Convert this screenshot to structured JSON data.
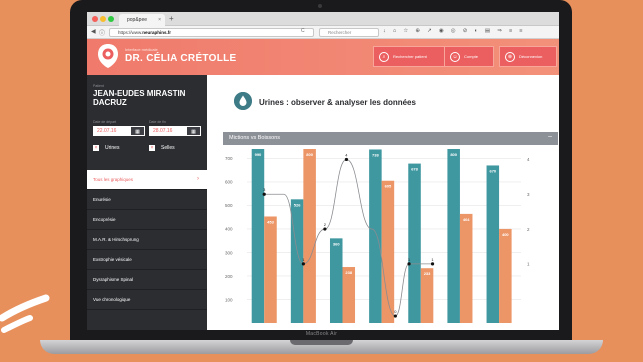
{
  "device": {
    "label": "MacBook Air"
  },
  "browser": {
    "tab_title": "pop&pee",
    "tab_close": "×",
    "tab_new": "+",
    "url_prefix": "https://www.",
    "url_domain": "neuraphins.fr",
    "url_reload_icon": "C",
    "search_placeholder": "Rechercher",
    "toolbar_icons": "↓ ⌂ ☆ ⊕ ↗ ◉ ◎ ⊘ ◐ ▤ ⇒ ≡ ≡"
  },
  "app": {
    "subtitle": "Interface médicale",
    "doctor_name": "DR. CÉLIA CRÉTOLLE",
    "buttons": [
      {
        "label": "Rechercher patient",
        "icon": "search-icon",
        "glyph": "⌕"
      },
      {
        "label": "Compte",
        "icon": "user-icon",
        "glyph": "☺"
      },
      {
        "label": "Déconnexion",
        "icon": "logout-icon",
        "glyph": "⊗"
      }
    ]
  },
  "sidebar": {
    "patient_label": "Patient",
    "patient_name": "JEAN-EUDES MIRASTIN DACRUZ",
    "date_start_label": "Date de départ",
    "date_end_label": "Date de fin",
    "date_start": "22.07.16",
    "date_end": "28.07.16",
    "calendar_glyph": "▦",
    "check_glyph": "×",
    "filters": [
      "Urines",
      "Selles"
    ],
    "menu": [
      {
        "label": "Tous les graphiques",
        "active": true,
        "chevron": "›"
      },
      {
        "label": "Enurésie",
        "active": false
      },
      {
        "label": "Encoprésie",
        "active": false
      },
      {
        "label": "M.A.R. & Hirschsprung",
        "active": false
      },
      {
        "label": "Exstrophie vésicale",
        "active": false
      },
      {
        "label": "Dysraphisme Spinal",
        "active": false
      },
      {
        "label": "Vue chronologique",
        "active": false
      }
    ]
  },
  "main": {
    "title": "Urines : observer & analyser les données",
    "panel_title": "Mictions vs Boissons",
    "panel_minimize": "–"
  },
  "chart_data": {
    "type": "bar",
    "y_ticks": [
      100,
      200,
      300,
      400,
      500,
      600,
      700
    ],
    "ylim": [
      0,
      740
    ],
    "y2_ticks": [
      1,
      2,
      3,
      4
    ],
    "y2lim": [
      -0.7,
      4.3
    ],
    "grid": true,
    "series": [
      {
        "values": [
          990,
          526,
          360,
          738,
          678,
          800,
          670
        ],
        "color": "#3f97a0"
      },
      {
        "values": [
          453,
          800,
          238,
          605,
          233,
          464,
          400
        ],
        "color": "#ec9566"
      }
    ],
    "line": {
      "x_days": [
        0.0,
        0.5,
        1.0,
        1.55,
        2.1,
        2.75,
        3.35,
        3.7,
        4.3
      ],
      "values": [
        3,
        3,
        1,
        2,
        4,
        2,
        -0.5,
        1,
        1
      ],
      "point_labels": [
        "3",
        "",
        "1",
        "2",
        "4",
        "",
        "0",
        "1",
        "1"
      ],
      "color": "#8a8c90",
      "marker": "#111111"
    }
  }
}
